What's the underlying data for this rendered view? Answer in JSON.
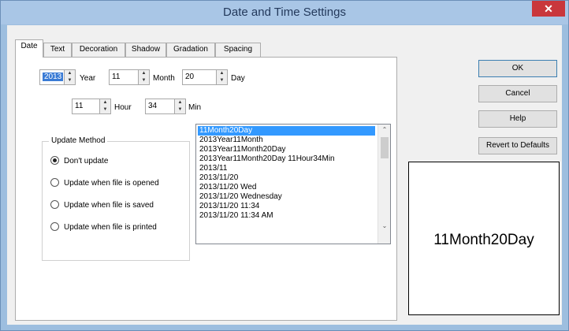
{
  "window": {
    "title": "Date and Time Settings",
    "close_glyph": "✕"
  },
  "tabs": [
    {
      "label": "Date",
      "active": true
    },
    {
      "label": "Text"
    },
    {
      "label": "Decoration"
    },
    {
      "label": "Shadow"
    },
    {
      "label": "Gradation"
    },
    {
      "label": "Spacing"
    }
  ],
  "date": {
    "year_value": "2013",
    "year_label": "Year",
    "month_value": "11",
    "month_label": "Month",
    "day_value": "20",
    "day_label": "Day",
    "hour_value": "11",
    "hour_label": "Hour",
    "min_value": "34",
    "min_label": "Min"
  },
  "update_method": {
    "title": "Update Method",
    "options": [
      {
        "label": "Don't update",
        "selected": true
      },
      {
        "label": "Update when file is opened"
      },
      {
        "label": "Update when file is saved"
      },
      {
        "label": "Update when file is printed"
      }
    ]
  },
  "formats": {
    "items": [
      "11Month20Day",
      "2013Year11Month",
      "2013Year11Month20Day",
      "2013Year11Month20Day 11Hour34Min",
      "2013/11",
      "2013/11/20",
      "2013/11/20 Wed",
      "2013/11/20 Wednesday",
      "2013/11/20 11:34",
      "2013/11/20 11:34 AM"
    ],
    "selected_index": 0
  },
  "buttons": {
    "ok": "OK",
    "cancel": "Cancel",
    "help": "Help",
    "revert": "Revert to Defaults"
  },
  "preview": {
    "text": "11Month20Day"
  }
}
